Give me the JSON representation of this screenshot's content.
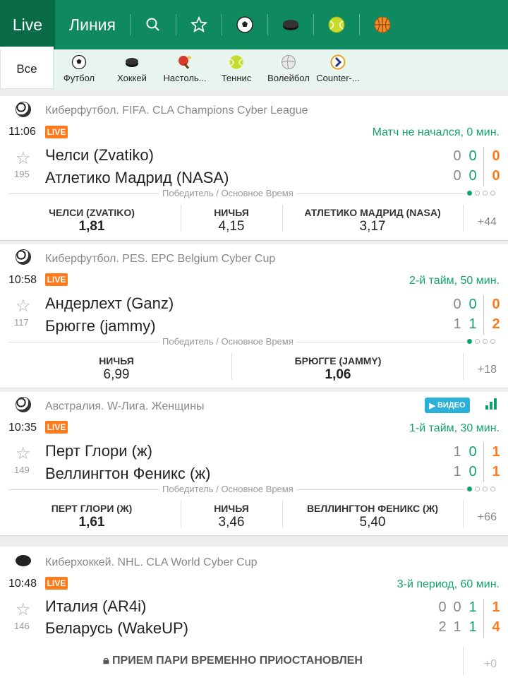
{
  "topnav": {
    "live_label": "Live",
    "line_label": "Линия"
  },
  "filters": {
    "all_label": "Все",
    "items": [
      {
        "label": "Футбол",
        "icon": "soccer-ball-icon"
      },
      {
        "label": "Хоккей",
        "icon": "hockey-puck-icon"
      },
      {
        "label": "Настоль...",
        "icon": "table-tennis-icon"
      },
      {
        "label": "Теннис",
        "icon": "tennis-ball-icon"
      },
      {
        "label": "Волейбол",
        "icon": "volleyball-icon"
      },
      {
        "label": "Counter-...",
        "icon": "counter-strike-icon"
      }
    ]
  },
  "matches": [
    {
      "league": "Киберфутбол. FIFA. CLA Champions Cyber League",
      "time": "11:06",
      "live": "LIVE",
      "status": "Матч не начался, 0 мин.",
      "count": "195",
      "team1": "Челси (Zvatiko)",
      "team2": "Атлетико Мадрид (NASA)",
      "market": "Победитель / Основное Время",
      "odd1_label": "ЧЕЛСИ (ZVATIKO)",
      "odd1_value": "1,81",
      "oddx_label": "НИЧЬЯ",
      "oddx_value": "4,15",
      "odd2_label": "АТЛЕТИКО МАДРИД (NASA)",
      "odd2_value": "3,17",
      "more": "+44"
    },
    {
      "league": "Киберфутбол. PES. EPC Belgium Cyber Cup",
      "time": "10:58",
      "live": "LIVE",
      "status": "2-й тайм, 50 мин.",
      "count": "117",
      "team1": "Андерлехт (Ganz)",
      "team2": "Брюгге (jammy)",
      "market": "Победитель / Основное Время",
      "oddx_label": "НИЧЬЯ",
      "oddx_value": "6,99",
      "odd2_label": "БРЮГГЕ (JAMMY)",
      "odd2_value": "1,06",
      "more": "+18"
    },
    {
      "league": "Австралия. W-Лига. Женщины",
      "time": "10:35",
      "live": "LIVE",
      "status": "1-й тайм, 30 мин.",
      "video": "ВИДЕО",
      "count": "149",
      "team1": "Перт Глори (ж)",
      "team2": "Веллингтон Феникс (ж)",
      "market": "Победитель / Основное Время",
      "odd1_label": "ПЕРТ ГЛОРИ (Ж)",
      "odd1_value": "1,61",
      "oddx_label": "НИЧЬЯ",
      "oddx_value": "3,46",
      "odd2_label": "ВЕЛЛИНГТОН ФЕНИКС (Ж)",
      "odd2_value": "5,40",
      "more": "+66"
    },
    {
      "league": "Киберхоккей. NHL. CLA World Cyber Cup",
      "time": "10:48",
      "live": "LIVE",
      "status": "3-й период, 60 мин.",
      "count": "146",
      "team1": "Италия (AR4i)",
      "team2": "Беларусь (WakeUP)",
      "suspended": "ПРИЕМ ПАРИ ВРЕМЕННО ПРИОСТАНОВЛЕН",
      "more": "+0"
    }
  ],
  "scores": {
    "m1": {
      "t1": [
        "0",
        "0",
        "0"
      ],
      "t2": [
        "0",
        "0",
        "0"
      ]
    },
    "m2": {
      "t1": [
        "0",
        "0",
        "0"
      ],
      "t2": [
        "1",
        "1",
        "2"
      ]
    },
    "m3": {
      "t1": [
        "1",
        "0",
        "1"
      ],
      "t2": [
        "1",
        "0",
        "1"
      ]
    },
    "m4": {
      "t1": [
        "0",
        "0",
        "1",
        "1"
      ],
      "t2": [
        "2",
        "1",
        "1",
        "4"
      ]
    }
  },
  "colors": {
    "brand": "#0f8a5f",
    "accent": "#ff7a1a",
    "status": "#11a36b"
  }
}
